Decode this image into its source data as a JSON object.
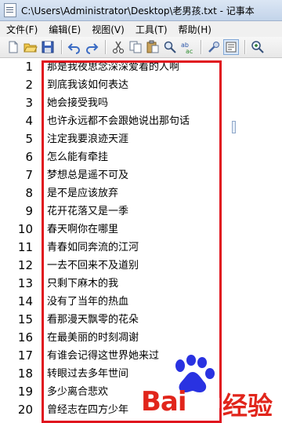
{
  "window": {
    "title": "C:\\Users\\Administrator\\Desktop\\老男孩.txt - 记事本"
  },
  "menu": {
    "items": [
      "文件(F)",
      "编辑(E)",
      "视图(V)",
      "工具(T)",
      "帮助(H)"
    ]
  },
  "toolbar": {
    "icons": [
      "new-file-icon",
      "open-file-icon",
      "save-icon",
      "undo-icon",
      "redo-icon",
      "cut-icon",
      "copy-icon",
      "paste-icon",
      "find-icon",
      "replace-icon",
      "tools-icon",
      "options-icon",
      "zoom-icon"
    ]
  },
  "editor": {
    "lines": [
      {
        "num": "1",
        "text": "那是我夜思念深深爱着的人啊"
      },
      {
        "num": "2",
        "text": "到底我该如何表达"
      },
      {
        "num": "3",
        "text": "她会接受我吗"
      },
      {
        "num": "4",
        "text": "也许永远都不会跟她说出那句话"
      },
      {
        "num": "5",
        "text": "注定我要浪迹天涯"
      },
      {
        "num": "6",
        "text": "怎么能有牵挂"
      },
      {
        "num": "7",
        "text": "梦想总是遥不可及"
      },
      {
        "num": "8",
        "text": "是不是应该放弃"
      },
      {
        "num": "9",
        "text": "花开花落又是一季"
      },
      {
        "num": "10",
        "text": "春天啊你在哪里"
      },
      {
        "num": "11",
        "text": "青春如同奔流的江河"
      },
      {
        "num": "12",
        "text": "一去不回来不及道别"
      },
      {
        "num": "13",
        "text": "只剩下麻木的我"
      },
      {
        "num": "14",
        "text": "没有了当年的热血"
      },
      {
        "num": "15",
        "text": "看那漫天飘零的花朵"
      },
      {
        "num": "16",
        "text": "在最美丽的时刻凋谢"
      },
      {
        "num": "17",
        "text": "有谁会记得这世界她来过"
      },
      {
        "num": "18",
        "text": "转眼过去多年世间"
      },
      {
        "num": "19",
        "text": "多少离合悲欢"
      },
      {
        "num": "20",
        "text": "曾经志在四方少年"
      }
    ],
    "highlight_color": "#e0141e"
  },
  "watermark": {
    "brand_bai": "Bai",
    "brand_du": "du",
    "brand_jingyan": "经验",
    "colors": {
      "red": "#e1251b",
      "blue": "#2932e1"
    }
  }
}
